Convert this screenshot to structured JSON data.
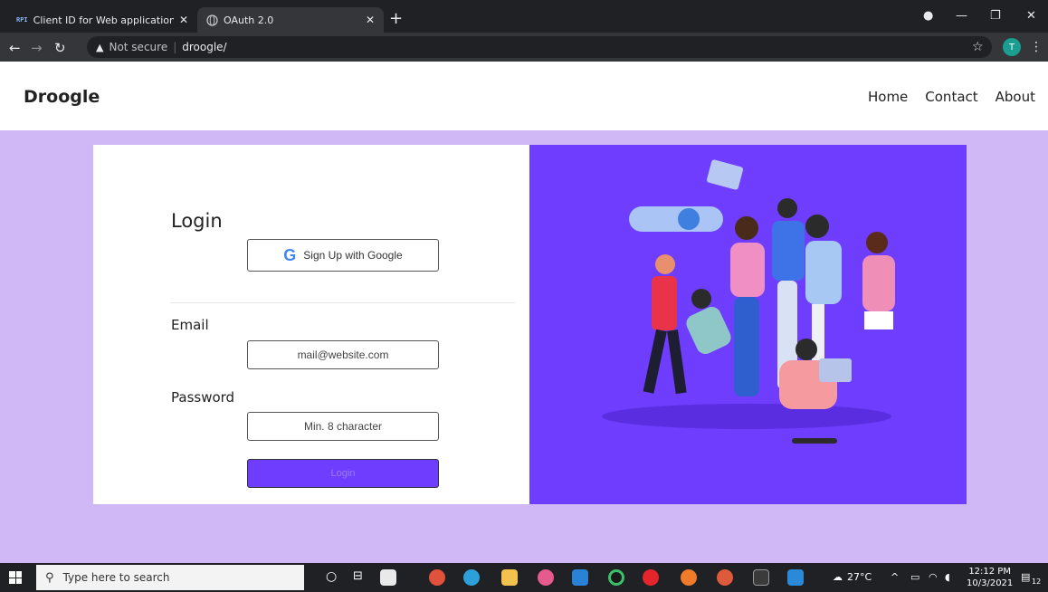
{
  "browser": {
    "tabs": [
      {
        "favicon": "RPI",
        "title": "Client ID for Web application – A"
      },
      {
        "favicon": "globe-icon",
        "title": "OAuth 2.0"
      }
    ],
    "security_label": "Not secure",
    "url": "droogle/",
    "profile_initial": "T"
  },
  "site": {
    "brand": "Droogle",
    "nav": [
      "Home",
      "Contact",
      "About"
    ]
  },
  "login": {
    "title": "Login",
    "google_button": "Sign Up with Google",
    "email_label": "Email",
    "email_placeholder": "mail@website.com",
    "password_label": "Password",
    "password_placeholder": "Min. 8 character",
    "submit_label": "Login"
  },
  "taskbar": {
    "search_placeholder": "Type here to search",
    "temperature": "27°C",
    "time": "12:12 PM",
    "date": "10/3/2021",
    "notifications": "12"
  },
  "colors": {
    "page_bg": "#cfb8f5",
    "accent": "#6e3dfd"
  }
}
